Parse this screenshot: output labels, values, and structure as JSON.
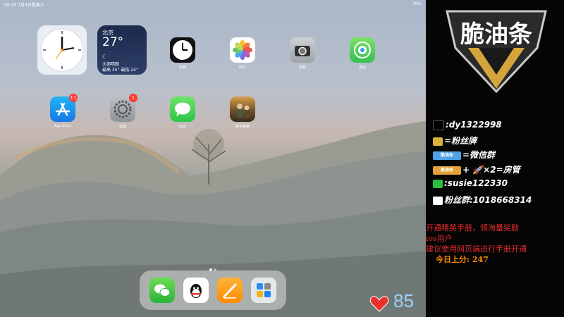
{
  "statusbar": {
    "time": "09:15",
    "date": "7月5日星期六",
    "battery": "79%"
  },
  "clock_widget": {
    "hour_hand": "clock"
  },
  "weather_widget": {
    "city": "北京",
    "temp": "27°",
    "cond": "大部晴朗",
    "range": "最高 35° 最低 24°"
  },
  "apps_row1": [
    {
      "name": "时钟",
      "icon": "clock-icon"
    },
    {
      "name": "照片",
      "icon": "photos-icon"
    },
    {
      "name": "相机",
      "icon": "camera-icon"
    },
    {
      "name": "查找",
      "icon": "findmy-icon"
    }
  ],
  "apps_row2": [
    {
      "name": "App Store",
      "icon": "appstore-icon",
      "badge": "11"
    },
    {
      "name": "设置",
      "icon": "settings-icon",
      "badge": "1"
    },
    {
      "name": "信息",
      "icon": "messages-icon"
    },
    {
      "name": "和平精英",
      "icon": "game-icon"
    }
  ],
  "dock": [
    "wechat-icon",
    "qq-icon",
    "pages-icon",
    "app-library-icon"
  ],
  "overlay": {
    "logo_text": "脆油条",
    "rows": [
      {
        "icon": "tiktok-icon",
        "text": ":dy1322998",
        "color": "#000000"
      },
      {
        "icon": "fan-badge-icon",
        "text": "=粉丝牌",
        "color": "#d9b33a"
      },
      {
        "icon": "fan-club-icon",
        "text": "=微信群",
        "color": "#4fa2e8",
        "chip": "脆油条"
      },
      {
        "icon": "rocket-icon",
        "text": "+ 🚀×2=房管",
        "color": "#e6a23a",
        "chip": "脆油条"
      },
      {
        "icon": "wechat-icon",
        "text": ":susie122330",
        "color": "#2bbd3b"
      },
      {
        "icon": "qq-icon",
        "text": "粉丝群:1018668314",
        "color": "#000000"
      }
    ]
  },
  "notice": {
    "line1": "开通精英手册，领海量奖励",
    "line2": "ios用户",
    "line3": "建议使用网页端进行手册开通",
    "today_label": "今日上分:",
    "today_value": "247"
  },
  "likes": {
    "count": "85"
  }
}
